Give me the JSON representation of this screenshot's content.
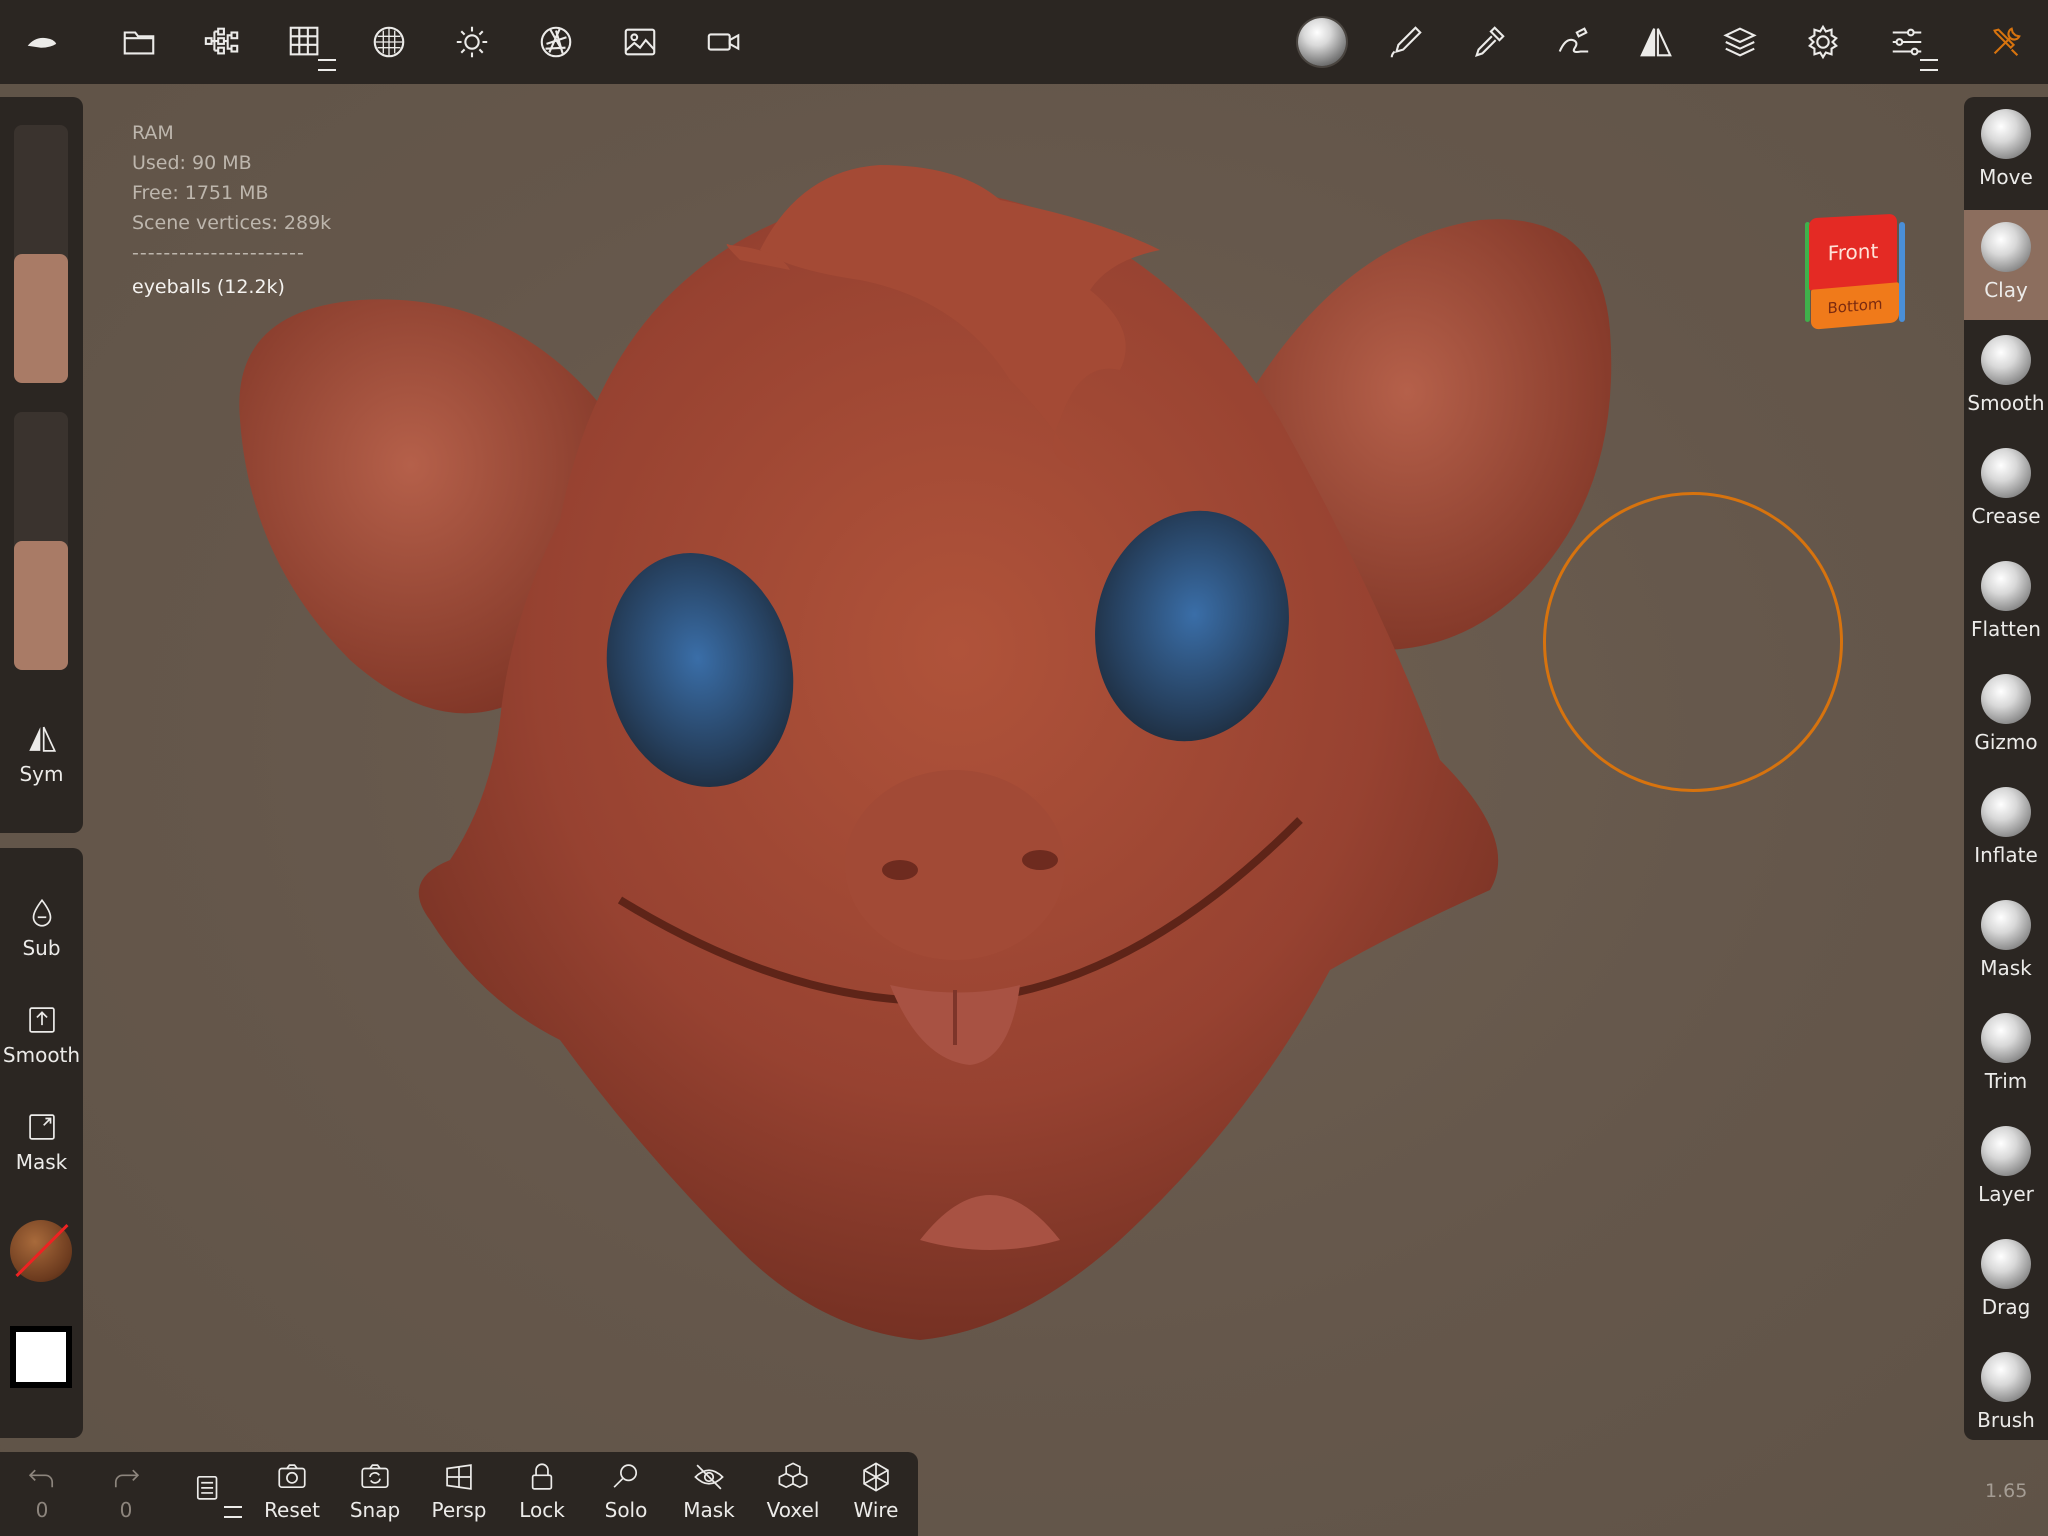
{
  "topbar": {
    "left_icons": [
      "logo-icon",
      "folder-icon",
      "scene-tree-icon",
      "grid-icon",
      "matcap-icon",
      "sun-icon",
      "aperture-icon",
      "image-icon",
      "camera-icon"
    ],
    "right_icons": [
      "material-sphere-icon",
      "paint-icon",
      "picker-icon",
      "stroke-icon",
      "symmetry-icon",
      "layers-icon",
      "gear-icon",
      "sliders-icon",
      "tools-icon"
    ],
    "accent": "#d7730e"
  },
  "info": {
    "ram_label": "RAM",
    "used": "Used: 90 MB",
    "free": "Free: 1751 MB",
    "vertices": "Scene vertices: 289k",
    "separator": "----------------------",
    "object": "eyeballs (12.2k)"
  },
  "left": {
    "sliders": [
      {
        "name": "radius",
        "level": 0.5
      },
      {
        "name": "intensity",
        "level": 0.5
      }
    ],
    "sym_label": "Sym",
    "sub_label": "Sub",
    "smooth_label": "Smooth",
    "mask_label": "Mask",
    "primary_color": "#ffffff"
  },
  "tools": [
    {
      "label": "Move",
      "active": false
    },
    {
      "label": "Clay",
      "active": true
    },
    {
      "label": "Smooth",
      "active": false
    },
    {
      "label": "Crease",
      "active": false
    },
    {
      "label": "Flatten",
      "active": false
    },
    {
      "label": "Gizmo",
      "active": false
    },
    {
      "label": "Inflate",
      "active": false
    },
    {
      "label": "Mask",
      "active": false
    },
    {
      "label": "Trim",
      "active": false
    },
    {
      "label": "Layer",
      "active": false
    },
    {
      "label": "Drag",
      "active": false
    },
    {
      "label": "Brush",
      "active": false
    }
  ],
  "gizmo_cube": {
    "front": "Front",
    "bottom": "Bottom"
  },
  "bottom": {
    "undo_count": "0",
    "redo_count": "0",
    "buttons": [
      "Reset",
      "Snap",
      "Persp",
      "Lock",
      "Solo",
      "Mask",
      "Voxel",
      "Wire"
    ]
  },
  "zoom": "1.65"
}
